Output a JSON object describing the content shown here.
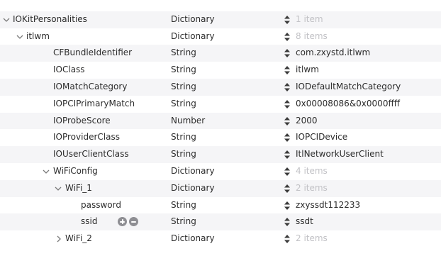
{
  "rows": [
    {
      "key": "",
      "type": "",
      "value": "",
      "value_is_count": true
    },
    {
      "key": "IOKitPersonalities",
      "type": "Dictionary",
      "value": "1 item",
      "value_is_count": true,
      "expanded": true
    },
    {
      "key": "itlwm",
      "type": "Dictionary",
      "value": "8 items",
      "value_is_count": true,
      "expanded": true
    },
    {
      "key": "CFBundleIdentifier",
      "type": "String",
      "value": "com.zxystd.itlwm",
      "value_is_count": false
    },
    {
      "key": "IOClass",
      "type": "String",
      "value": "itlwm",
      "value_is_count": false
    },
    {
      "key": "IOMatchCategory",
      "type": "String",
      "value": "IODefaultMatchCategory",
      "value_is_count": false
    },
    {
      "key": "IOPCIPrimaryMatch",
      "type": "String",
      "value": "0x00008086&0x0000ffff",
      "value_is_count": false
    },
    {
      "key": "IOProbeScore",
      "type": "Number",
      "value": "2000",
      "value_is_count": false
    },
    {
      "key": "IOProviderClass",
      "type": "String",
      "value": "IOPCIDevice",
      "value_is_count": false
    },
    {
      "key": "IOUserClientClass",
      "type": "String",
      "value": "ItlNetworkUserClient",
      "value_is_count": false
    },
    {
      "key": "WiFiConfig",
      "type": "Dictionary",
      "value": "4 items",
      "value_is_count": true,
      "expanded": true
    },
    {
      "key": "WiFi_1",
      "type": "Dictionary",
      "value": "2 items",
      "value_is_count": true,
      "expanded": true
    },
    {
      "key": "password",
      "type": "String",
      "value": "zxyssdt112233",
      "value_is_count": false
    },
    {
      "key": "ssid",
      "type": "String",
      "value": "ssdt",
      "value_is_count": false,
      "selected_row_controls": true
    },
    {
      "key": "WiFi_2",
      "type": "Dictionary",
      "value": "2 items",
      "value_is_count": true,
      "expanded": false
    }
  ],
  "icons": {
    "expanded": "chevron-down-icon",
    "collapsed": "chevron-right-icon",
    "stepper": "up-down-stepper-icon",
    "add": "plus-circle-icon",
    "remove": "minus-circle-icon"
  },
  "colors": {
    "stripe": "#f5f5f7",
    "count_text": "#c2c2c6",
    "row_button": "#8e8e93"
  }
}
